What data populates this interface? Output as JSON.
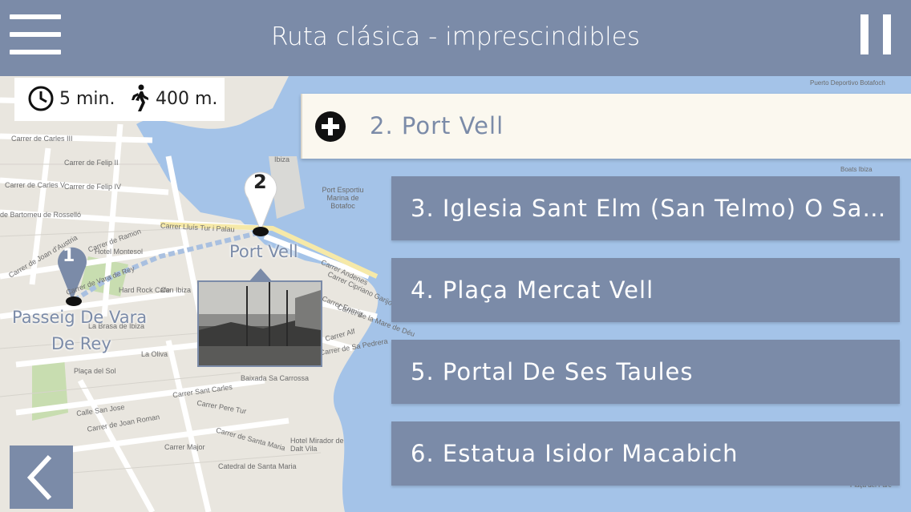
{
  "header": {
    "title": "Ruta clásica - imprescindibles"
  },
  "info": {
    "duration": "5 min.",
    "distance": "400 m."
  },
  "route": {
    "active_item": "2. Port Vell",
    "items": [
      "3. Iglesia Sant Elm (San Telmo) O Sa…",
      "4. Plaça Mercat Vell",
      "5. Portal De Ses Taules",
      "6. Estatua Isidor Macabich"
    ]
  },
  "map": {
    "pins": [
      {
        "number": "1",
        "label_line1": "Passeig De Vara",
        "label_line2": "De Rey"
      },
      {
        "number": "2",
        "label": "Port Vell"
      }
    ],
    "street_labels": [
      "Carrer de Carles III",
      "Carrer de Felip II",
      "Carrer de Carles V",
      "Carrer de Felip IV",
      "de Bartomeu de Rosselló",
      "Carrer Lluís Tur i Palau",
      "Carrer de Joan d'Austria",
      "Hotel Montesol",
      "Carrer de Ramon",
      "Carrer de Vara de Rey",
      "Hard Rock Cafe",
      "Can Ibiza",
      "La Brasa de Ibiza",
      "La Oliva",
      "Plaça del Sol",
      "Carrer Sant Carles",
      "Calle San Jose",
      "Carrer de Joan Roman",
      "Carrer Major",
      "Carrer de Santa Maria",
      "Catedral de Santa Maria",
      "Hotel Mirador de Dalt Vila",
      "Carrer Andenes",
      "Carrer Cipriano Garijo",
      "Carrer Enmig",
      "Carrer de la Mare de Déu",
      "Carrer Alf",
      "Carrer de Sa Pedrera",
      "Baixada Sa Carrossa",
      "Carrer Pere Tur",
      "Port Esportiu Marina de Botafoc",
      "Ibiza",
      "Puerto Deportivo Botafoch",
      "Boats Ibiza",
      "Plaça del Parc"
    ]
  },
  "icons": {
    "menu": "hamburger-menu-icon",
    "pause": "pause-icon",
    "clock": "clock-icon",
    "walk": "walking-person-icon",
    "add": "plus-circle-icon",
    "back": "chevron-left-icon"
  },
  "colors": {
    "header": "#7b8ba8",
    "active_item_bg": "#fbf8ef",
    "water": "#a4c3e8",
    "land": "#e9e6df"
  }
}
